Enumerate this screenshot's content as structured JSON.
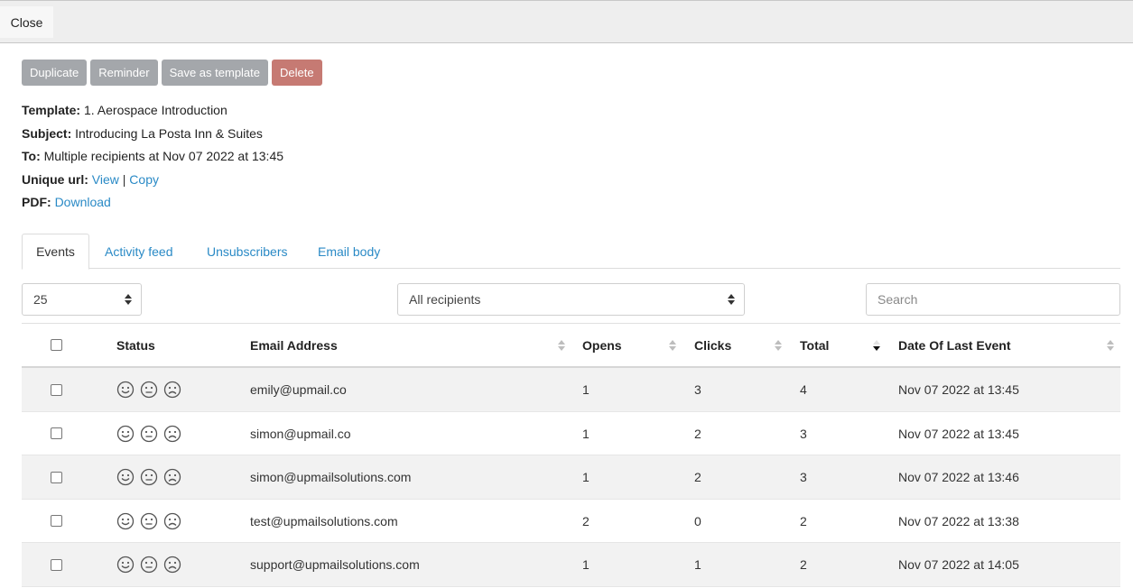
{
  "topbar": {
    "close_label": "Close"
  },
  "actions": {
    "duplicate": "Duplicate",
    "reminder": "Reminder",
    "save_template": "Save as template",
    "delete": "Delete"
  },
  "meta": {
    "template_label": "Template:",
    "template_value": "1. Aerospace Introduction",
    "subject_label": "Subject:",
    "subject_value": "Introducing La Posta Inn & Suites",
    "to_label": "To:",
    "to_value": "Multiple recipients at Nov 07 2022 at 13:45",
    "unique_url_label": "Unique url:",
    "view_link": "View",
    "separator": "|",
    "copy_link": "Copy",
    "pdf_label": "PDF:",
    "download_link": "Download"
  },
  "tabs": [
    "Events",
    "Activity feed",
    "Unsubscribers",
    "Email body"
  ],
  "filters": {
    "page_size": "25",
    "recipients": "All recipients",
    "search_placeholder": "Search"
  },
  "table": {
    "columns": [
      "Status",
      "Email Address",
      "Opens",
      "Clicks",
      "Total",
      "Date Of Last Event"
    ],
    "rows": [
      {
        "email": "emily@upmail.co",
        "opens": "1",
        "clicks": "3",
        "total": "4",
        "date": "Nov 07 2022 at 13:45"
      },
      {
        "email": "simon@upmail.co",
        "opens": "1",
        "clicks": "2",
        "total": "3",
        "date": "Nov 07 2022 at 13:45"
      },
      {
        "email": "simon@upmailsolutions.com",
        "opens": "1",
        "clicks": "2",
        "total": "3",
        "date": "Nov 07 2022 at 13:46"
      },
      {
        "email": "test@upmailsolutions.com",
        "opens": "2",
        "clicks": "0",
        "total": "2",
        "date": "Nov 07 2022 at 13:38"
      },
      {
        "email": "support@upmailsolutions.com",
        "opens": "1",
        "clicks": "1",
        "total": "2",
        "date": "Nov 07 2022 at 14:05"
      }
    ]
  },
  "colors": {
    "link": "#2a8ac6",
    "button_grey": "#a4a7ab",
    "button_delete": "#c67a73",
    "row_stripe": "#f2f2f2"
  },
  "icons": [
    "happy-face-icon",
    "neutral-face-icon",
    "sad-face-icon",
    "sort-icon",
    "sort-desc-icon",
    "select-arrows-icon"
  ]
}
